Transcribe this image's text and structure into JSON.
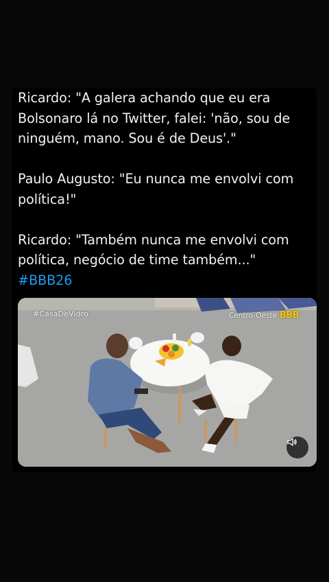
{
  "tweet": {
    "lines_1": [
      "Ricardo: \"A galera achando que eu era",
      "Bolsonaro lá no Twitter, falei: 'não, sou de",
      "ninguém, mano. Sou é de Deus'.\""
    ],
    "lines_2": [
      "Paulo Augusto: \"Eu nunca me envolvi com",
      "política!\""
    ],
    "lines_3": [
      "Ricardo: \"Também nunca me envolvi com",
      "política, negócio de time também...\""
    ],
    "hashtag": "#BBB26"
  },
  "media": {
    "overlay_left": "#CasaDeVidro",
    "overlay_right": "Centro-Oeste",
    "logo": "BBB",
    "volume_icon": "volume-icon"
  },
  "colors": {
    "background": "#080808",
    "text": "#f2f2f2",
    "hashtag": "#1d9bf0"
  }
}
